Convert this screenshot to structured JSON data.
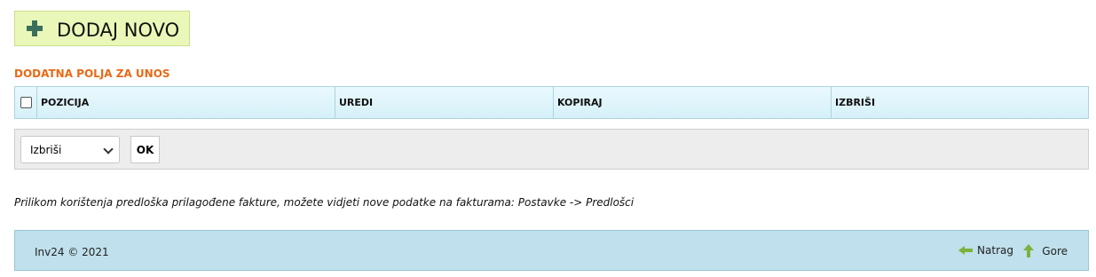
{
  "toolbar": {
    "add_new_label": "DODAJ NOVO"
  },
  "section": {
    "title": "DODATNA POLJA ZA UNOS"
  },
  "table": {
    "columns": [
      "POZICIJA",
      "UREDI",
      "KOPIRAJ",
      "IZBRIŠI"
    ]
  },
  "bulk_actions": {
    "selected_action": "Izbriši",
    "ok_label": "OK"
  },
  "info_text": "Prilikom korištenja predloška prilagođene fakture, možete vidjeti nove podatke na fakturama: Postavke -> Predlošci",
  "footer": {
    "copyright": "Inv24 © 2021",
    "back_label": "Natrag",
    "up_label": "Gore"
  },
  "colors": {
    "add_button_bg": "#e9f8b8",
    "section_title": "#e86a17",
    "footer_bg": "#bfe0ec",
    "arrow_green": "#7cb23c"
  }
}
